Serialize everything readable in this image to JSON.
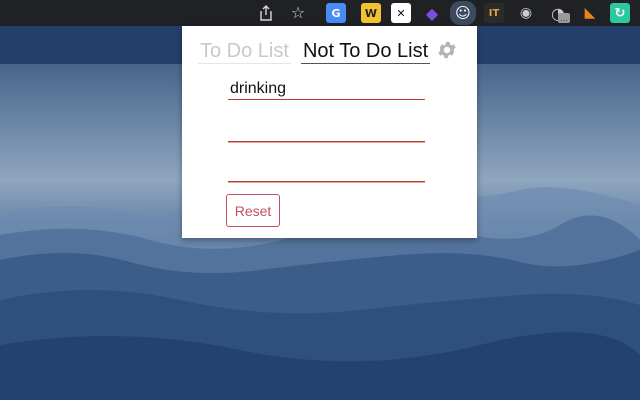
{
  "browser": {
    "extensions": [
      {
        "name": "google-translate-icon",
        "glyph": "G",
        "color": "#4a8af4"
      },
      {
        "name": "w-extension-icon",
        "glyph": "W",
        "color": "#f2c230"
      },
      {
        "name": "x-extension-icon",
        "glyph": "✕",
        "color": "#ffffff"
      },
      {
        "name": "stack-extension-icon",
        "glyph": "◆",
        "color": "#7a4ee3"
      },
      {
        "name": "stormtrooper-extension-icon",
        "glyph": "☺",
        "color": "#ffffff"
      },
      {
        "name": "it-extension-icon",
        "glyph": "IT",
        "color": "#e0a23a"
      },
      {
        "name": "camera-extension-icon",
        "glyph": "◉",
        "color": "#cccccc"
      },
      {
        "name": "gauge-extension-icon",
        "glyph": "◔",
        "color": "#cccccc"
      },
      {
        "name": "metamask-extension-icon",
        "glyph": "◣",
        "color": "#e8821e"
      },
      {
        "name": "refresh-extension-icon",
        "glyph": "↻",
        "color": "#2bc9a0"
      }
    ]
  },
  "popup": {
    "tabs": {
      "todo_label": "To Do List",
      "not_todo_label": "Not To Do List"
    },
    "items": [
      "drinking",
      "",
      ""
    ],
    "reset_label": "Reset"
  },
  "colors": {
    "accent": "#c2505f",
    "toolbar": "#202124",
    "background": "#2b4770"
  }
}
